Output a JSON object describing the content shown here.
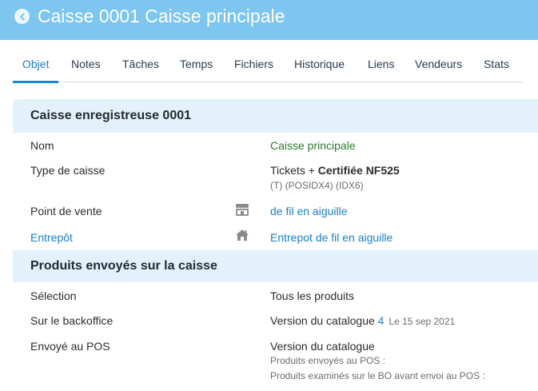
{
  "header": {
    "title": "Caisse 0001 Caisse principale",
    "back_icon": "chevron-left-icon",
    "background_color": "#7cc6f0"
  },
  "tabs": [
    {
      "label": "Objet",
      "active": true
    },
    {
      "label": "Notes"
    },
    {
      "label": "Tâches"
    },
    {
      "label": "Temps"
    },
    {
      "label": "Fichiers"
    },
    {
      "label": "Historique"
    },
    {
      "label": "Liens"
    },
    {
      "label": "Vendeurs"
    },
    {
      "label": "Stats"
    }
  ],
  "section1": {
    "title": "Caisse enregistreuse 0001",
    "rows": {
      "nom": {
        "label": "Nom",
        "value": "Caisse principale"
      },
      "type": {
        "label": "Type de caisse",
        "value_prefix": "Tickets + ",
        "value_bold": "Certifiée NF525",
        "detail": "(T) (POSIDX4) (IDX6)"
      },
      "point_de_vente": {
        "label": "Point de vente",
        "icon": "store-icon",
        "value": "de fil en aiguille"
      },
      "entrepot": {
        "label": "Entrepôt",
        "icon": "home-icon",
        "value": "Entrepot de fil en aiguille"
      }
    }
  },
  "section2": {
    "title": "Produits envoyés sur la caisse",
    "rows": {
      "selection": {
        "label": "Sélection",
        "value": "Tous les produits"
      },
      "backoffice": {
        "label": "Sur le backoffice",
        "value": "Version du catalogue ",
        "version": "4",
        "date": "Le 15 sep 2021"
      },
      "pos": {
        "label": "Envoyé au POS",
        "value": "Version du catalogue",
        "detail1": "Produits envoyés au POS :",
        "detail2": "Produits examinés sur le BO avant envoi au POS :"
      }
    }
  },
  "colors": {
    "accent": "#1b7fc4",
    "green": "#2d7a2d",
    "section_bg": "#e3f1fa"
  }
}
